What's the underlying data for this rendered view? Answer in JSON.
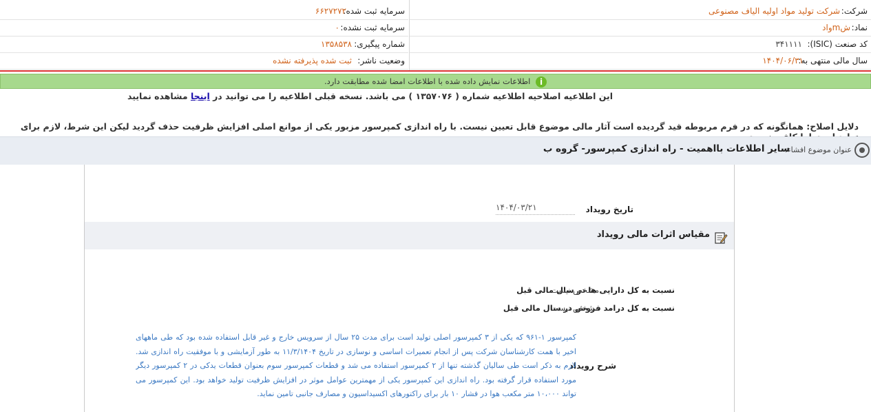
{
  "header": {
    "company_label": "شرکت:",
    "company_value": "شرکت تولید مواد اولیه الیاف مصنوعی",
    "symbol_label": "نماد:",
    "symbol_value": "شmواد",
    "isic_label": "کد صنعت (ISIC):",
    "isic_value": "۳۴۱۱۱۱",
    "fiscal_label": "سال مالی منتهی به:",
    "fiscal_value": "۱۴۰۴/۰۶/۳۱",
    "reg_capital_label": "سرمایه ثبت شده:",
    "reg_capital_value": "۶۶۲۷۲۷۲",
    "unreg_capital_label": "سرمایه ثبت نشده:",
    "unreg_capital_value": "۰",
    "tracking_label": "شماره پیگیری:",
    "tracking_value": "۱۳۵۸۵۳۸",
    "publisher_status_label": "وضعیت ناشر:",
    "publisher_status_value": "ثبت شده پذیرفته نشده"
  },
  "notice": {
    "icon": "info-icon",
    "text": "اطلاعات نمایش داده شده با اطلاعات امضا شده مطابقت دارد."
  },
  "correction": {
    "text_before": "این اطلاعیه اصلاحیه اطلاعیه شماره ( ۱۳۵۷۰۷۶ ) می باشد. نسخه قبلی اطلاعیه را می توانید در",
    "link_text": "اینجا",
    "text_after": "مشاهده نمایید",
    "reasons": "دلایل اصلاح: همانگونه که در فرم مربوطه قید گردیده است آثار مالی موضوع قابل تعیین نیست. با راه اندازی کمپرسور مزبور یکی از موانع اصلی افزایش ظرفیت حذف گردید لیکن این شرط، لازم برای تولید است اما کافی نیست."
  },
  "topic": {
    "icon": "target-icon",
    "label": "عنوان موضوع افشاء:",
    "value": "سایر اطلاعات بااهمیت - راه اندازی کمپرسور- گروه ب"
  },
  "event": {
    "date_label": "تاریخ رویداد",
    "date_value": "۱۴۰۴/۰۳/۲۱",
    "section_icon": "edit-icon",
    "section_title": "مقیاس اثرات مالی رویداد",
    "assets_label": "نسبت به کل دارایی ها در سال مالی قبل",
    "assets_value": "مشخص نیست",
    "revenue_label": "نسبت به کل درامد فروش در سال مالی قبل",
    "revenue_value": "مشخص نیست",
    "description_label": "شرح رویداد",
    "description": "کمپرسور ۱-۹۶۱ که یکی از ۳ کمپرسور اصلی تولید است برای مدت ۲۵ سال از سرویس خارج و غیر قابل استفاده شده بود که طی ماههای اخیر با همت کارشناسان شرکت پس از انجام تعمیرات اساسی و نوسازی در تاریخ ۱۱/۳/۱۴۰۴ به طور آزمایشی و با موفقیت راه اندازی شد. لازم به ذکر است طی سالیان گذشته تنها از ۲ کمپرسور استفاده می شد و قطعات کمپرسور سوم بعنوان قطعات یدکی در ۲ کمپرسور دیگر مورد استفاده قرار گرفته بود. راه اندازی این کمپرسور یکی از مهمترین عوامل موثر در افزایش ظرفیت تولید خواهد بود. این کمپرسور می تواند ۱۰،۰۰۰ متر مکعب هوا در فشار ۱۰ بار برای راکتورهای اکسیداسیون و مصارف جانبی تامین نماید."
  }
}
